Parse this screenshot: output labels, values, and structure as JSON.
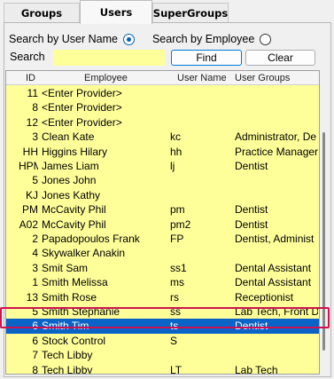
{
  "tabs": [
    {
      "label": "Groups"
    },
    {
      "label": "Users"
    },
    {
      "label": "SuperGroups"
    }
  ],
  "search": {
    "by_user_name_label": "Search by User Name",
    "by_employee_label": "Search by Employee",
    "search_label": "Search",
    "input_value": "",
    "find_label": "Find",
    "clear_label": "Clear",
    "selected_mode": "user_name"
  },
  "grid": {
    "headers": {
      "id": "ID",
      "employee": "Employee",
      "user_name": "User Name",
      "user_groups": "User Groups"
    },
    "rows": [
      {
        "key": false,
        "id": "11",
        "employee": "<Enter Provider>",
        "user_name": "",
        "user_groups": ""
      },
      {
        "key": false,
        "id": "8",
        "employee": "<Enter Provider>",
        "user_name": "",
        "user_groups": ""
      },
      {
        "key": false,
        "id": "12",
        "employee": "<Enter Provider>",
        "user_name": "",
        "user_groups": ""
      },
      {
        "key": true,
        "id": "3",
        "employee": "Clean Kate",
        "user_name": "kc",
        "user_groups": "Administrator, De"
      },
      {
        "key": false,
        "id": "HH",
        "employee": "Higgins Hilary",
        "user_name": "hh",
        "user_groups": "Practice Manager"
      },
      {
        "key": false,
        "id": "HPM",
        "employee": "James Liam",
        "user_name": "lj",
        "user_groups": "Dentist"
      },
      {
        "key": false,
        "id": "5",
        "employee": "Jones John",
        "user_name": "",
        "user_groups": ""
      },
      {
        "key": false,
        "id": "KJ",
        "employee": "Jones Kathy",
        "user_name": "",
        "user_groups": ""
      },
      {
        "key": true,
        "id": "PM",
        "employee": "McCavity Phil",
        "user_name": "pm",
        "user_groups": "Dentist"
      },
      {
        "key": true,
        "id": "A02",
        "employee": "McCavity Phil",
        "user_name": "pm2",
        "user_groups": "Dentist"
      },
      {
        "key": true,
        "id": "2",
        "employee": "Papadopoulos Frank",
        "user_name": "FP",
        "user_groups": "Dentist, Administ"
      },
      {
        "key": false,
        "id": "4",
        "employee": "Skywalker Anakin",
        "user_name": "",
        "user_groups": ""
      },
      {
        "key": true,
        "id": "3",
        "employee": "Smit Sam",
        "user_name": "ss1",
        "user_groups": "Dental Assistant"
      },
      {
        "key": true,
        "id": "1",
        "employee": "Smith Melissa",
        "user_name": "ms",
        "user_groups": "Dental Assistant"
      },
      {
        "key": false,
        "id": "13",
        "employee": "Smith Rose",
        "user_name": "rs",
        "user_groups": "Receptionist"
      },
      {
        "key": true,
        "id": "5",
        "employee": "Smith Stephanie",
        "user_name": "ss",
        "user_groups": "Lab Tech, Front D"
      },
      {
        "key": false,
        "id": "6",
        "employee": "Smith Tim",
        "user_name": "ts",
        "user_groups": "Dentist",
        "selected": true
      },
      {
        "key": true,
        "id": "6",
        "employee": "Stock  Control",
        "user_name": "S",
        "user_groups": ""
      },
      {
        "key": false,
        "id": "7",
        "employee": "Tech Libby",
        "user_name": "",
        "user_groups": ""
      },
      {
        "key": true,
        "id": "8",
        "employee": "Tech Libby",
        "user_name": "LT",
        "user_groups": "Lab Tech"
      }
    ]
  },
  "colors": {
    "grid_bg": "#ffff9a",
    "selected_bg": "#0a63c7",
    "highlight_border": "#d0114f"
  },
  "icons": {
    "key": "key-icon"
  }
}
